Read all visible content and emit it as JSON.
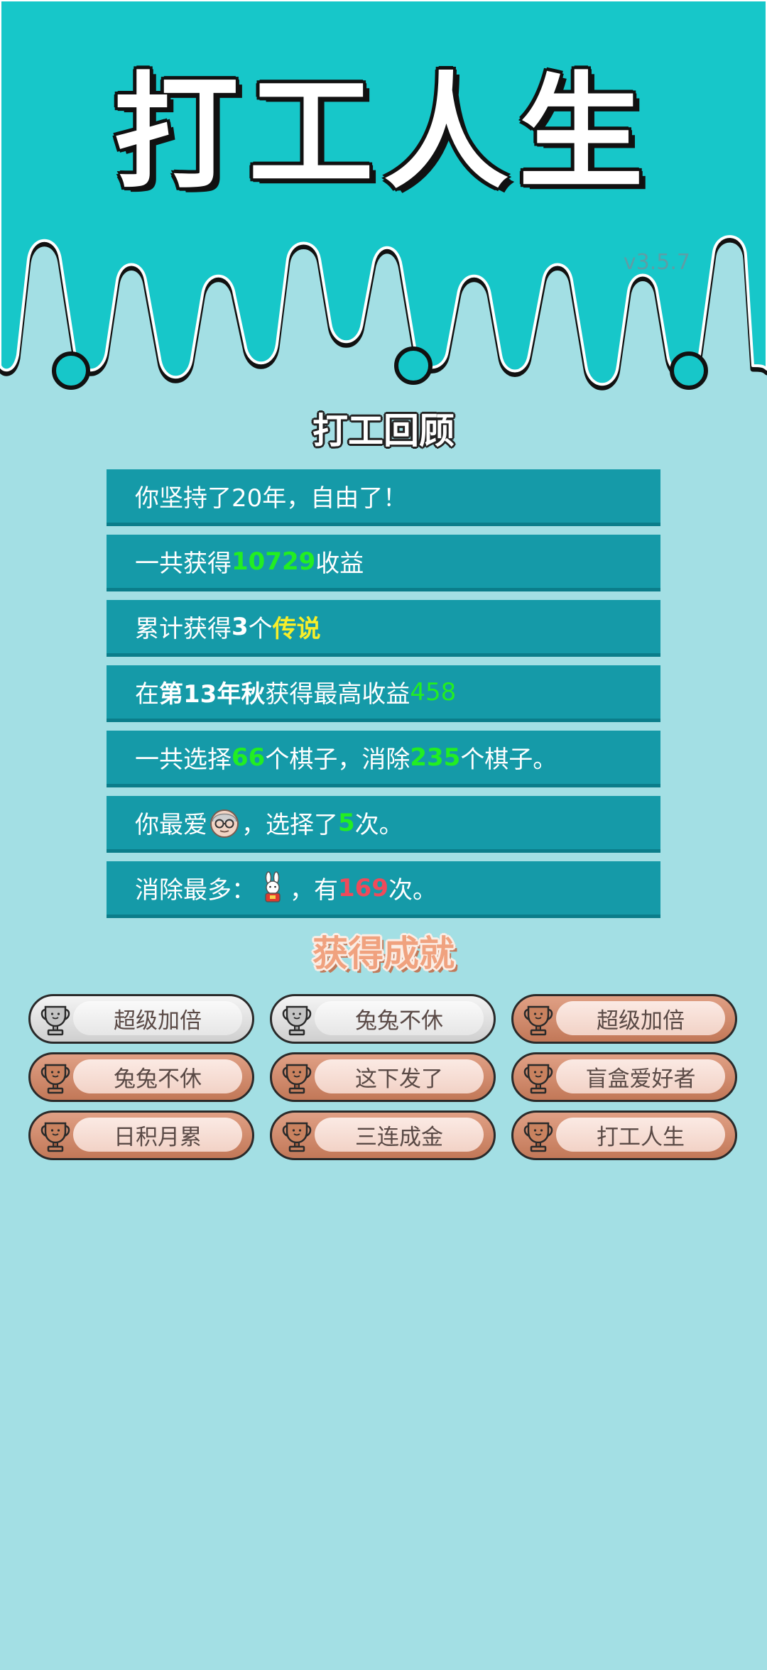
{
  "app": {
    "title": "打工人生",
    "version": "v3.5.7"
  },
  "review": {
    "title": "打工回顾",
    "rows": [
      {
        "id": "years",
        "parts": [
          {
            "t": "你坚持了20年，自由了！",
            "s": "plain"
          }
        ]
      },
      {
        "id": "income",
        "parts": [
          {
            "t": "一共获得",
            "s": "plain"
          },
          {
            "t": "10729",
            "s": "green"
          },
          {
            "t": "收益",
            "s": "plain"
          }
        ]
      },
      {
        "id": "legend",
        "parts": [
          {
            "t": "累计获得",
            "s": "plain"
          },
          {
            "t": "3",
            "s": "white-bold"
          },
          {
            "t": "个",
            "s": "plain"
          },
          {
            "t": "传说",
            "s": "yellow"
          }
        ]
      },
      {
        "id": "best",
        "parts": [
          {
            "t": "在 ",
            "s": "plain"
          },
          {
            "t": "第13年秋",
            "s": "white-bold"
          },
          {
            "t": " 获得最高收益",
            "s": "plain"
          },
          {
            "t": "458",
            "s": "green-thin"
          }
        ]
      },
      {
        "id": "pieces",
        "parts": [
          {
            "t": "一共选择",
            "s": "plain"
          },
          {
            "t": "66",
            "s": "green"
          },
          {
            "t": "个棋子，消除",
            "s": "plain"
          },
          {
            "t": "235",
            "s": "green"
          },
          {
            "t": "个棋子。",
            "s": "plain"
          }
        ]
      },
      {
        "id": "favorite",
        "parts": [
          {
            "t": "你最爱",
            "s": "plain"
          },
          {
            "icon": "old-man-face-icon"
          },
          {
            "t": "，选择了",
            "s": "plain"
          },
          {
            "t": "5",
            "s": "green"
          },
          {
            "t": "次。",
            "s": "plain"
          }
        ]
      },
      {
        "id": "most-eliminated",
        "parts": [
          {
            "t": "消除最多：",
            "s": "plain"
          },
          {
            "icon": "rabbit-icon"
          },
          {
            "t": "，有",
            "s": "plain"
          },
          {
            "t": "169",
            "s": "red"
          },
          {
            "t": "次。",
            "s": "plain"
          }
        ]
      }
    ]
  },
  "achievements": {
    "title": "获得成就",
    "items": [
      {
        "label": "超级加倍",
        "tier": "silver"
      },
      {
        "label": "兔兔不休",
        "tier": "silver"
      },
      {
        "label": "超级加倍",
        "tier": "bronze"
      },
      {
        "label": "兔兔不休",
        "tier": "bronze"
      },
      {
        "label": "这下发了",
        "tier": "bronze"
      },
      {
        "label": "盲盒爱好者",
        "tier": "bronze"
      },
      {
        "label": "日积月累",
        "tier": "bronze"
      },
      {
        "label": "三连成金",
        "tier": "bronze"
      },
      {
        "label": "打工人生",
        "tier": "bronze"
      }
    ]
  },
  "colors": {
    "header_teal": "#17c7c9",
    "page_bg": "#a3dfe4",
    "row_bg": "#159aa8",
    "highlight_green": "#22ee22",
    "highlight_yellow": "#f7ee2a",
    "highlight_red": "#f04a5a"
  }
}
